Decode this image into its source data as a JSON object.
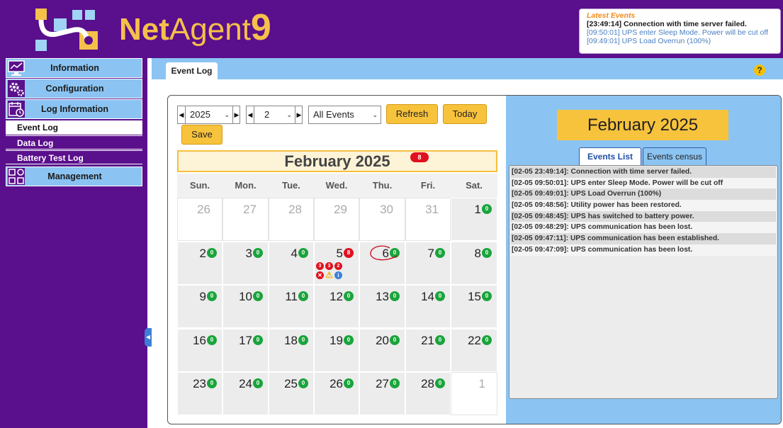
{
  "header": {
    "brand_part1": "Net",
    "brand_part2": "Agent",
    "brand_part3": "9",
    "latest_title": "Latest Events",
    "latest_events": [
      "[23:49:14] Connection with time server failed.",
      "[09:50:01] UPS enter Sleep Mode. Power will be cut off",
      "[09:49:01] UPS Load Overrun (100%)"
    ]
  },
  "sidebar": {
    "information": "Information",
    "configuration": "Configuration",
    "log_information": "Log Information",
    "sub_items": [
      "Event Log",
      "Data Log",
      "Battery Test Log"
    ],
    "management": "Management"
  },
  "main": {
    "tab": "Event Log",
    "help": "?"
  },
  "controls": {
    "year": "2025",
    "month": "2",
    "filter": "All Events",
    "refresh": "Refresh",
    "today": "Today",
    "save": "Save"
  },
  "calendar": {
    "title": "February 2025",
    "badge": "8",
    "weekdays": [
      "Sun.",
      "Mon.",
      "Tue.",
      "Wed.",
      "Thu.",
      "Fri.",
      "Sat."
    ],
    "weeks": [
      [
        {
          "d": "26",
          "o": true
        },
        {
          "d": "27",
          "o": true
        },
        {
          "d": "28",
          "o": true
        },
        {
          "d": "29",
          "o": true
        },
        {
          "d": "30",
          "o": true
        },
        {
          "d": "31",
          "o": true
        },
        {
          "d": "1",
          "b": "0"
        }
      ],
      [
        {
          "d": "2",
          "b": "0"
        },
        {
          "d": "3",
          "b": "0"
        },
        {
          "d": "4",
          "b": "0"
        },
        {
          "d": "5",
          "b": "8",
          "red": true
        },
        {
          "d": "6",
          "b": "0"
        },
        {
          "d": "7",
          "b": "0"
        },
        {
          "d": "8",
          "b": "0"
        }
      ],
      [
        {
          "d": "9",
          "b": "0"
        },
        {
          "d": "10",
          "b": "0"
        },
        {
          "d": "11",
          "b": "0"
        },
        {
          "d": "12",
          "b": "0"
        },
        {
          "d": "13",
          "b": "0"
        },
        {
          "d": "14",
          "b": "0"
        },
        {
          "d": "15",
          "b": "0"
        }
      ],
      [
        {
          "d": "16",
          "b": "0"
        },
        {
          "d": "17",
          "b": "0"
        },
        {
          "d": "18",
          "b": "0"
        },
        {
          "d": "19",
          "b": "0"
        },
        {
          "d": "20",
          "b": "0"
        },
        {
          "d": "21",
          "b": "0"
        },
        {
          "d": "22",
          "b": "0"
        }
      ],
      [
        {
          "d": "23",
          "b": "0"
        },
        {
          "d": "24",
          "b": "0"
        },
        {
          "d": "25",
          "b": "0"
        },
        {
          "d": "26",
          "b": "0"
        },
        {
          "d": "27",
          "b": "0"
        },
        {
          "d": "28",
          "b": "0"
        },
        {
          "d": "1",
          "o": true
        }
      ]
    ],
    "severity_counts": [
      "3",
      "3",
      "2"
    ]
  },
  "right": {
    "month_title": "February 2025",
    "tab_list": "Events List",
    "tab_census": "Events census",
    "events": [
      "[02-05 23:49:14]: Connection with time server failed.",
      "[02-05 09:50:01]: UPS enter Sleep Mode. Power will be cut off",
      "[02-05 09:49:01]: UPS Load Overrun (100%)",
      "[02-05 09:48:56]: Utility power has been restored.",
      "[02-05 09:48:45]: UPS has switched to battery power.",
      "[02-05 09:48:29]: UPS communication has been lost.",
      "[02-05 09:47:11]: UPS communication has been established.",
      "[02-05 09:47:09]: UPS communication has been lost."
    ]
  },
  "colors": {
    "brand_purple": "#5a0f8c",
    "brand_gold": "#f5c04a",
    "light_blue": "#8bc4f2",
    "button_yellow": "#f8c33c",
    "badge_green": "#1aa43c",
    "badge_red": "#e0101e"
  }
}
